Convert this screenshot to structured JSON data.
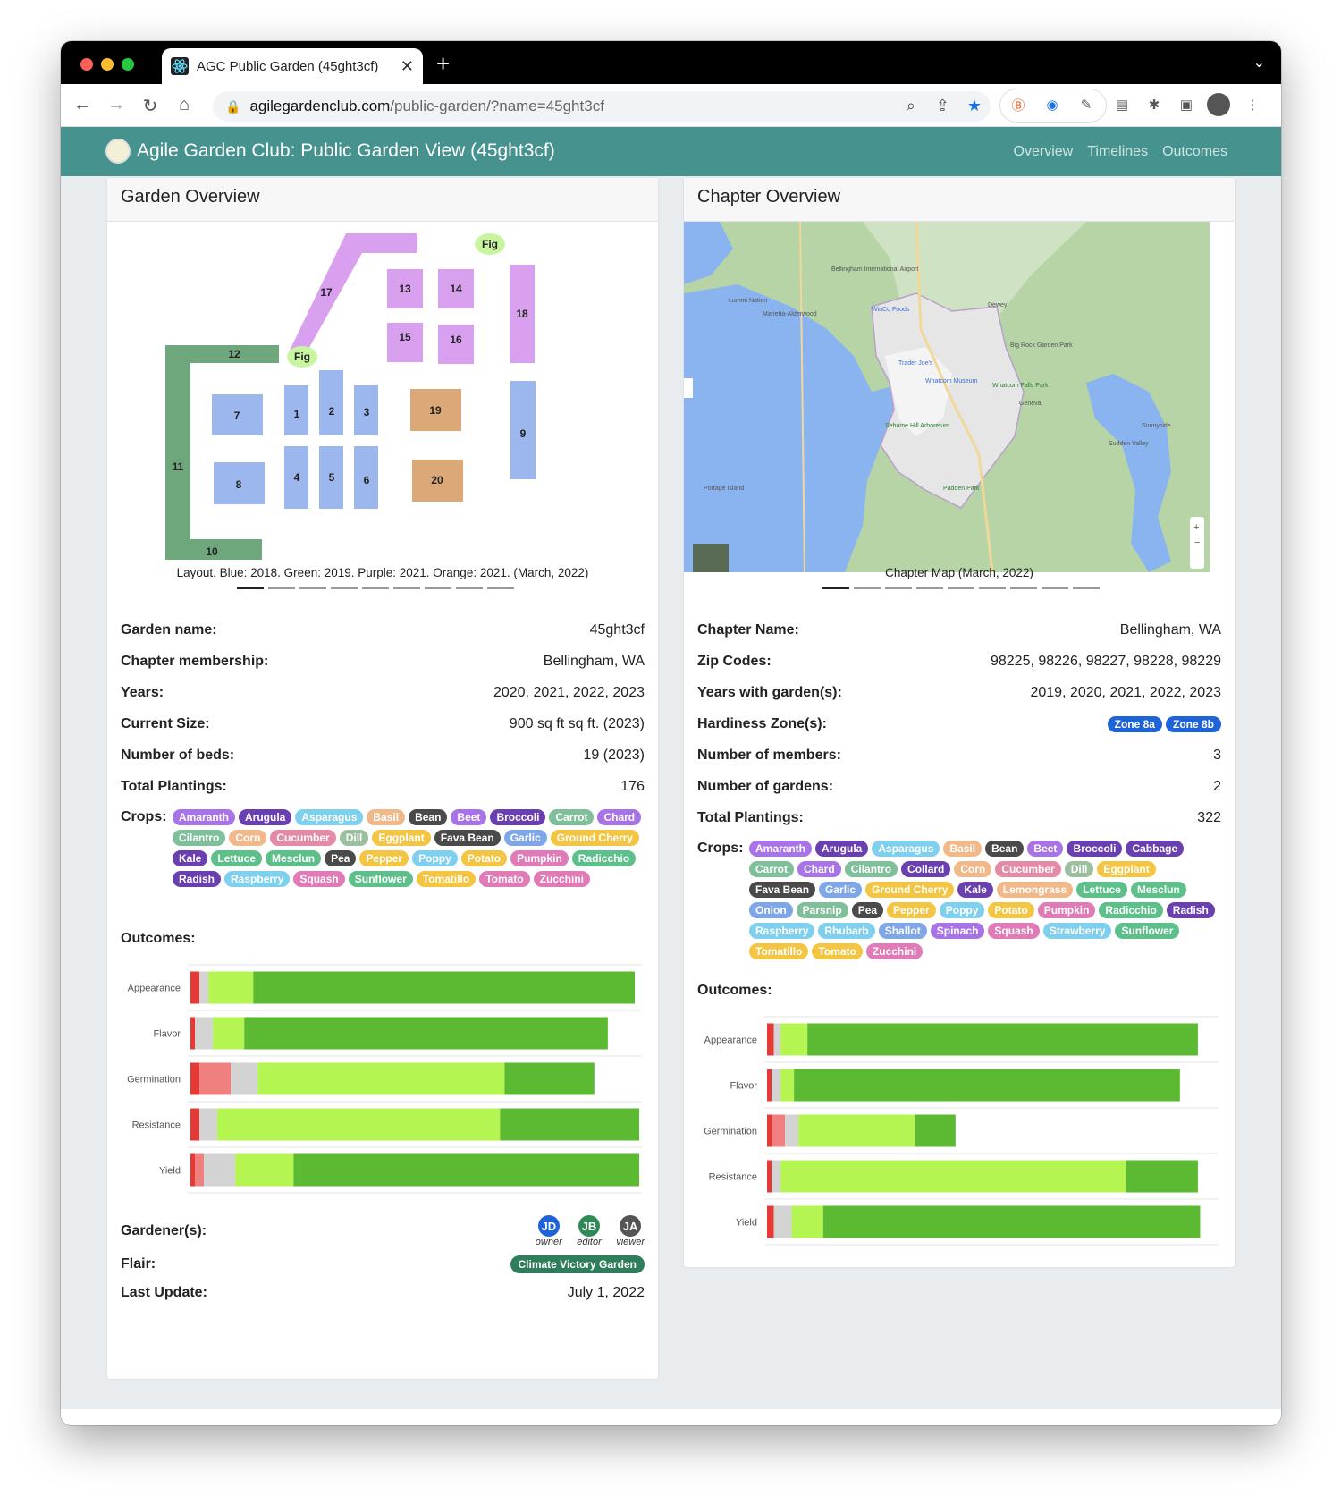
{
  "browser": {
    "tab_title": "AGC Public Garden (45ght3cf)",
    "url_host": "agilegardenclub.com",
    "url_path": "/public-garden/?name=45ght3cf"
  },
  "app": {
    "title": "Agile Garden Club: Public Garden View (45ght3cf)",
    "nav": [
      "Overview",
      "Timelines",
      "Outcomes"
    ]
  },
  "garden": {
    "header": "Garden Overview",
    "caption": "Layout. Blue: 2018. Green: 2019. Purple: 2021. Orange: 2021. (March, 2022)",
    "layout_labels": {
      "b1": "1",
      "b2": "2",
      "b3": "3",
      "b4": "4",
      "b5": "5",
      "b6": "6",
      "b7": "7",
      "b8": "8",
      "b9": "9",
      "b10": "10",
      "b11": "11",
      "b12": "12",
      "b13": "13",
      "b14": "14",
      "b15": "15",
      "b16": "16",
      "b17": "17",
      "b18": "18",
      "b19": "19",
      "b20": "20",
      "fig": "Fig"
    },
    "fields": [
      {
        "k": "Garden name:",
        "v": "45ght3cf"
      },
      {
        "k": "Chapter membership:",
        "v": "Bellingham, WA"
      },
      {
        "k": "Years:",
        "v": "2020, 2021, 2022, 2023"
      },
      {
        "k": "Current Size:",
        "v": "900 sq ft sq ft. (2023)"
      },
      {
        "k": "Number of beds:",
        "v": "19 (2023)"
      },
      {
        "k": "Total Plantings:",
        "v": "176"
      }
    ],
    "crops_label": "Crops:",
    "crops": [
      {
        "n": "Amaranth",
        "c": "#a873e6"
      },
      {
        "n": "Arugula",
        "c": "#6a3fb0"
      },
      {
        "n": "Asparagus",
        "c": "#7fd0ef"
      },
      {
        "n": "Basil",
        "c": "#f1b98a"
      },
      {
        "n": "Bean",
        "c": "#4a4a4a"
      },
      {
        "n": "Beet",
        "c": "#a873e6"
      },
      {
        "n": "Broccoli",
        "c": "#6a3fb0"
      },
      {
        "n": "Carrot",
        "c": "#7fbf9a"
      },
      {
        "n": "Chard",
        "c": "#a873e6"
      },
      {
        "n": "Cilantro",
        "c": "#7fbf9a"
      },
      {
        "n": "Corn",
        "c": "#f1b98a"
      },
      {
        "n": "Cucumber",
        "c": "#e58aa6"
      },
      {
        "n": "Dill",
        "c": "#9bbf9f"
      },
      {
        "n": "Eggplant",
        "c": "#f4c542"
      },
      {
        "n": "Fava Bean",
        "c": "#4a4a4a"
      },
      {
        "n": "Garlic",
        "c": "#7fa6e8"
      },
      {
        "n": "Ground Cherry",
        "c": "#f4c542"
      },
      {
        "n": "Kale",
        "c": "#6a3fb0"
      },
      {
        "n": "Lettuce",
        "c": "#5dbf8a"
      },
      {
        "n": "Mesclun",
        "c": "#5dbf8a"
      },
      {
        "n": "Pea",
        "c": "#4a4a4a"
      },
      {
        "n": "Pepper",
        "c": "#f4c542"
      },
      {
        "n": "Poppy",
        "c": "#7fd0ef"
      },
      {
        "n": "Potato",
        "c": "#f4c542"
      },
      {
        "n": "Pumpkin",
        "c": "#e07bb8"
      },
      {
        "n": "Radicchio",
        "c": "#5dbf8a"
      },
      {
        "n": "Radish",
        "c": "#6a3fb0"
      },
      {
        "n": "Raspberry",
        "c": "#7fd0ef"
      },
      {
        "n": "Squash",
        "c": "#e07bb8"
      },
      {
        "n": "Sunflower",
        "c": "#5dbf8a"
      },
      {
        "n": "Tomatillo",
        "c": "#f4c542"
      },
      {
        "n": "Tomato",
        "c": "#e07bb8"
      },
      {
        "n": "Zucchini",
        "c": "#e07bb8"
      }
    ],
    "outcomes_label": "Outcomes:",
    "gardeners_label": "Gardener(s):",
    "gardeners": [
      {
        "initials": "JD",
        "role": "owner",
        "color": "#1e63d8"
      },
      {
        "initials": "JB",
        "role": "editor",
        "color": "#2e8b57"
      },
      {
        "initials": "JA",
        "role": "viewer",
        "color": "#555555"
      }
    ],
    "flair_label": "Flair:",
    "flair": "Climate Victory Garden",
    "last_update_label": "Last Update:",
    "last_update": "July 1, 2022"
  },
  "chapter": {
    "header": "Chapter Overview",
    "caption": "Chapter Map (March, 2022)",
    "map_labels": {
      "lummi": "Lummi Nation",
      "marietta": "Marietta-Alderwood",
      "airport": "Bellingham International Airport",
      "winco": "WinCo Foods",
      "dewey": "Dewey",
      "bigrock": "Big Rock Garden Park",
      "traderjoes": "Trader Joe's",
      "whatcom": "Whatcom Museum",
      "falls": "Whatcom Falls Park",
      "geneva": "Geneva",
      "arboretum": "Sehome Hill Arboretum",
      "sudden": "Sudden Valley",
      "portage": "Portage Island",
      "padden": "Padden Park",
      "sunnyside": "Sunnyside"
    },
    "fields": [
      {
        "k": "Chapter Name:",
        "v": "Bellingham, WA"
      },
      {
        "k": "Zip Codes:",
        "v": "98225, 98226, 98227, 98228, 98229"
      },
      {
        "k": "Years with garden(s):",
        "v": "2019, 2020, 2021, 2022, 2023"
      }
    ],
    "zone_label": "Hardiness Zone(s):",
    "zones": [
      "Zone 8a",
      "Zone 8b"
    ],
    "fields2": [
      {
        "k": "Number of members:",
        "v": "3"
      },
      {
        "k": "Number of gardens:",
        "v": "2"
      },
      {
        "k": "Total Plantings:",
        "v": "322"
      }
    ],
    "crops_label": "Crops:",
    "crops": [
      {
        "n": "Amaranth",
        "c": "#a873e6"
      },
      {
        "n": "Arugula",
        "c": "#6a3fb0"
      },
      {
        "n": "Asparagus",
        "c": "#7fd0ef"
      },
      {
        "n": "Basil",
        "c": "#f1b98a"
      },
      {
        "n": "Bean",
        "c": "#4a4a4a"
      },
      {
        "n": "Beet",
        "c": "#a873e6"
      },
      {
        "n": "Broccoli",
        "c": "#6a3fb0"
      },
      {
        "n": "Cabbage",
        "c": "#6a3fb0"
      },
      {
        "n": "Carrot",
        "c": "#7fbf9a"
      },
      {
        "n": "Chard",
        "c": "#a873e6"
      },
      {
        "n": "Cilantro",
        "c": "#7fbf9a"
      },
      {
        "n": "Collard",
        "c": "#6a3fb0"
      },
      {
        "n": "Corn",
        "c": "#f1b98a"
      },
      {
        "n": "Cucumber",
        "c": "#e58aa6"
      },
      {
        "n": "Dill",
        "c": "#9bbf9f"
      },
      {
        "n": "Eggplant",
        "c": "#f4c542"
      },
      {
        "n": "Fava Bean",
        "c": "#4a4a4a"
      },
      {
        "n": "Garlic",
        "c": "#7fa6e8"
      },
      {
        "n": "Ground Cherry",
        "c": "#f4c542"
      },
      {
        "n": "Kale",
        "c": "#6a3fb0"
      },
      {
        "n": "Lemongrass",
        "c": "#f1b98a"
      },
      {
        "n": "Lettuce",
        "c": "#5dbf8a"
      },
      {
        "n": "Mesclun",
        "c": "#5dbf8a"
      },
      {
        "n": "Onion",
        "c": "#7fa6e8"
      },
      {
        "n": "Parsnip",
        "c": "#7fbf9a"
      },
      {
        "n": "Pea",
        "c": "#4a4a4a"
      },
      {
        "n": "Pepper",
        "c": "#f4c542"
      },
      {
        "n": "Poppy",
        "c": "#7fd0ef"
      },
      {
        "n": "Potato",
        "c": "#f4c542"
      },
      {
        "n": "Pumpkin",
        "c": "#e07bb8"
      },
      {
        "n": "Radicchio",
        "c": "#5dbf8a"
      },
      {
        "n": "Radish",
        "c": "#6a3fb0"
      },
      {
        "n": "Raspberry",
        "c": "#7fd0ef"
      },
      {
        "n": "Rhubarb",
        "c": "#7fd0ef"
      },
      {
        "n": "Shallot",
        "c": "#7fa6e8"
      },
      {
        "n": "Spinach",
        "c": "#a873e6"
      },
      {
        "n": "Squash",
        "c": "#e07bb8"
      },
      {
        "n": "Strawberry",
        "c": "#7fd0ef"
      },
      {
        "n": "Sunflower",
        "c": "#5dbf8a"
      },
      {
        "n": "Tomatillo",
        "c": "#f4c542"
      },
      {
        "n": "Tomato",
        "c": "#f4c542"
      },
      {
        "n": "Zucchini",
        "c": "#e07bb8"
      }
    ],
    "outcomes_label": "Outcomes:"
  },
  "chart_data": [
    {
      "type": "bar",
      "stacked": true,
      "orientation": "horizontal",
      "categories": [
        "Appearance",
        "Flavor",
        "Germination",
        "Resistance",
        "Yield"
      ],
      "xlim": [
        0,
        100
      ],
      "series": [
        {
          "color": "#e53935",
          "values": [
            2,
            1,
            2,
            2,
            1
          ]
        },
        {
          "color": "#f08080",
          "values": [
            0,
            0,
            7,
            0,
            2
          ]
        },
        {
          "color": "#d3d3d3",
          "values": [
            2,
            4,
            6,
            4,
            7
          ]
        },
        {
          "color": "#b5f552",
          "values": [
            10,
            7,
            55,
            63,
            13
          ]
        },
        {
          "color": "#5cb932",
          "values": [
            85,
            81,
            20,
            31,
            77
          ]
        }
      ]
    },
    {
      "type": "bar",
      "stacked": true,
      "orientation": "horizontal",
      "categories": [
        "Appearance",
        "Flavor",
        "Germination",
        "Resistance",
        "Yield"
      ],
      "xlim": [
        0,
        100
      ],
      "series": [
        {
          "color": "#e53935",
          "values": [
            1.5,
            1,
            1,
            1,
            1.5
          ]
        },
        {
          "color": "#f08080",
          "values": [
            0,
            0,
            3,
            0,
            0
          ]
        },
        {
          "color": "#d3d3d3",
          "values": [
            1.5,
            2,
            3,
            2,
            4
          ]
        },
        {
          "color": "#b5f552",
          "values": [
            6,
            3,
            26,
            77,
            7
          ]
        },
        {
          "color": "#5cb932",
          "values": [
            87,
            86,
            9,
            16,
            84
          ]
        }
      ]
    }
  ]
}
